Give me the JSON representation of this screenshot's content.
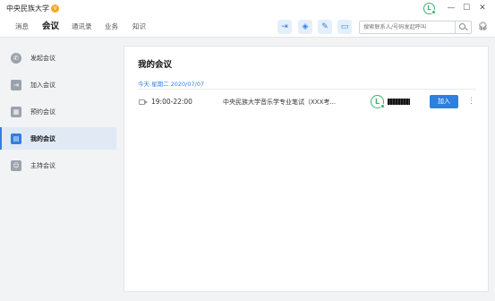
{
  "titlebar": {
    "title": "中央民族大学",
    "badge": "V",
    "avatar_letter": "L",
    "minimize": "—",
    "maximize": "☐",
    "close": "✕"
  },
  "nav": {
    "items": [
      {
        "label": "消息"
      },
      {
        "label": "会议"
      },
      {
        "label": "通讯录"
      },
      {
        "label": "业务"
      },
      {
        "label": "知识"
      }
    ],
    "active_index": 1,
    "search_placeholder": "搜索联系人/号码发起呼叫"
  },
  "sidebar": {
    "items": [
      {
        "label": "发起会议",
        "icon": "phone-icon"
      },
      {
        "label": "加入会议",
        "icon": "join-icon"
      },
      {
        "label": "预约会议",
        "icon": "calendar-icon"
      },
      {
        "label": "我的会议",
        "icon": "my-meeting-icon"
      },
      {
        "label": "主持会议",
        "icon": "host-icon"
      }
    ],
    "active_index": 3
  },
  "main": {
    "title": "我的会议",
    "date_line": "今天 星期二 2020/07/07",
    "meeting": {
      "time": "19:00-22:00",
      "title": "中央民族大学音乐学专业笔试（XXX考...",
      "host_avatar_letter": "L",
      "join_label": "加入",
      "more": "⋮"
    }
  },
  "colors": {
    "accent": "#2f7fe0",
    "online": "#3cb371",
    "badge": "#f5a623"
  }
}
